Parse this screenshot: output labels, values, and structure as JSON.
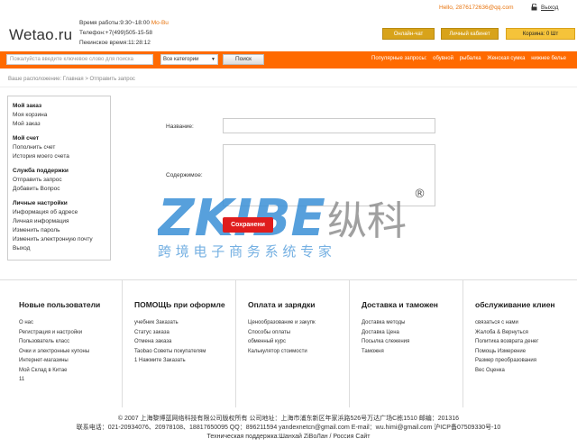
{
  "header": {
    "logo": "Wetao.ru",
    "hours_label": "Время работы:9:30~18:00",
    "hours_days": "Mo-Bu",
    "phone": "Телефон:+7(499)505-15-58",
    "beijing_time": "Пекинское время:11:28:12",
    "user_email": "Hello, 2876172636@qq.com",
    "logout_label": "Выход",
    "buttons": {
      "online_chat": "Онлайн-чат",
      "cabinet": "Личный кабинет",
      "cart": "Корзина: 0 Шт"
    }
  },
  "searchbar": {
    "placeholder": "Пожалуйста введите ключевое слово для поиска",
    "category": "Все категории",
    "search_button": "Поиск",
    "popular_label": "Популярные запросы:",
    "popular": [
      "обувной",
      "рыбалка",
      "Женская сумка",
      "нижнее белье"
    ]
  },
  "breadcrumb": "Ваше расположение: Главная > Отправить запрос",
  "sidebar": [
    {
      "title": "Мой заказ",
      "items": [
        "Моя корзина",
        "Мой заказ"
      ]
    },
    {
      "title": "Мой счет",
      "items": [
        "Пополнить счет",
        "История моего счета"
      ]
    },
    {
      "title": "Служба поддержки",
      "items": [
        "Отправить запрос",
        "Добавить Вопрос"
      ]
    },
    {
      "title": "Личные настройки",
      "items": [
        "Информация об адресе",
        "Личная информация",
        "Изменить пароль",
        "Изменить электронную почту",
        "Выход"
      ]
    }
  ],
  "form": {
    "name_label": "Название:",
    "content_label": "Содержимое:",
    "save_label": "Сохранени"
  },
  "watermark": {
    "brand": "ZKIBE",
    "cn_brand": "纵科",
    "tagline": "跨 境 电 子 商 务 系 统 专 家",
    "reg_mark": "®"
  },
  "footer": {
    "columns": [
      {
        "title": "Новые пользователи",
        "items": [
          "О нас",
          "Регистрация и настройки",
          "Пользователь класс",
          "Очки и электронные купоны",
          "Интернет-магазины",
          "Мой Склад в Китае",
          "11"
        ]
      },
      {
        "title": "ПОМОЩЬ при оформле",
        "items": [
          "учебник Заказать",
          "Статус заказа",
          "Отмена заказа",
          "Taobao Советы покупателям",
          "1 Нажмите Заказать"
        ]
      },
      {
        "title": "Оплата и зарядки",
        "items": [
          "Ценообразование и закупк",
          "Способы оплаты",
          "обменный курс",
          "Калькулятор стоимости"
        ]
      },
      {
        "title": "Доставка и таможен",
        "items": [
          "Доставка методы",
          "Доставка Цена",
          "Посылка слежения",
          "Таможня"
        ]
      },
      {
        "title": "обслуживание клиен",
        "items": [
          "связаться с нами",
          "Жалоба & Вернуться",
          "Политика возврата денег",
          "Помощь Измерение",
          "Размер преобразования",
          "Вес Оценка"
        ]
      }
    ],
    "copyright_line1": "© 2007 上海黎博蓝网络科技有限公司版权所有    公司地址：上海市浦东新区年家浜路526号万达广场C栋1510    邮编：201316",
    "copyright_line2": "联系电话：021-20934076、20978108、18817650095    QQ：896211594    yandexnetcn@gmail.com  E-mail：wu.himi@gmail.com    沪ICP备07509330号-10",
    "copyright_line3": "Техническая поддержка:Шанхай ZiBoЛан / Россия Сайт"
  },
  "colors": {
    "accent_orange": "#ff6a00",
    "button_gold": "#d8a31a",
    "save_red": "#e01d1d",
    "watermark_blue": "#3a8fd6"
  }
}
